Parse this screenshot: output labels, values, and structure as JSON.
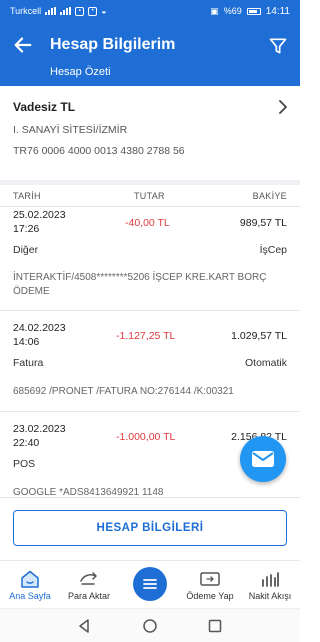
{
  "status_bar": {
    "carrier": "Turkcell",
    "battery": "%69",
    "time": "14:11"
  },
  "header": {
    "title": "Hesap Bilgilerim",
    "subtitle": "Hesap Özeti",
    "back_icon": "arrow-left-icon",
    "filter_icon": "filter-icon",
    "color": "#1e6ed6"
  },
  "account": {
    "name": "Vadesiz TL",
    "branch": "I. SANAYİ SİTESİ/İZMİR",
    "iban": "TR76 0006 4000 0013 4380 2788 56"
  },
  "table": {
    "columns": [
      "TARİH",
      "TUTAR",
      "BAKİYE"
    ],
    "rows": [
      {
        "date": "25.02.2023",
        "time": "17:26",
        "amount": "-40,00 TL",
        "balance": "989,57 TL",
        "category": "Diğer",
        "channel": "İşCep",
        "description": "İNTERAKTİF/4508********5206 İŞCEP KRE.KART BORÇ ÖDEME"
      },
      {
        "date": "24.02.2023",
        "time": "14:06",
        "amount": "-1.127,25 TL",
        "balance": "1.029,57 TL",
        "category": "Fatura",
        "channel": "Otomatik",
        "description": "685692 /PRONET /FATURA NO:276144 /K:00321"
      },
      {
        "date": "23.02.2023",
        "time": "22:40",
        "amount": "-1.000,00 TL",
        "balance": "2.156,82 TL",
        "category": "POS",
        "channel": "",
        "description": "GOOGLE *ADS8413649921 1148"
      }
    ],
    "negative_color": "#e0393e"
  },
  "fab": {
    "icon": "mail-icon",
    "color": "#2196f3"
  },
  "info_button": {
    "label": "HESAP BİLGİLERİ"
  },
  "tabs": [
    {
      "label": "Ana Sayfa",
      "icon": "home-icon",
      "active": true
    },
    {
      "label": "Para Aktar",
      "icon": "transfer-icon",
      "active": false
    },
    {
      "label": "",
      "icon": "menu-icon",
      "active": false
    },
    {
      "label": "Ödeme Yap",
      "icon": "payment-icon",
      "active": false
    },
    {
      "label": "Nakit Akışı",
      "icon": "cash-flow-icon",
      "active": false
    }
  ],
  "system_nav": [
    "back-icon",
    "home-icon",
    "recents-icon"
  ]
}
